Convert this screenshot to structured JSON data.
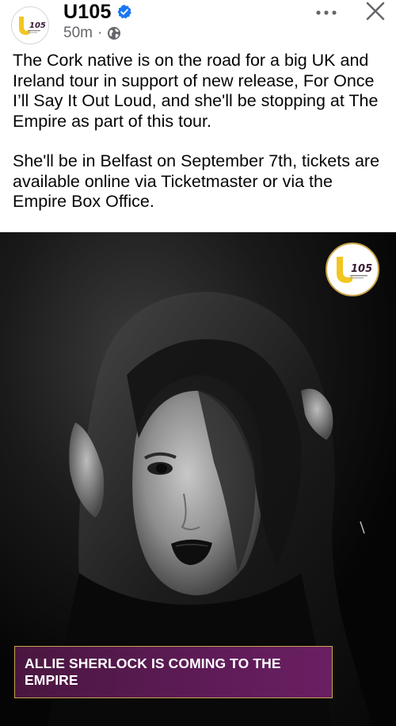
{
  "header": {
    "page_name": "U105",
    "timestamp": "50m",
    "separator": "·",
    "avatar_logo_text": "105",
    "avatar_logo_letter": "U",
    "verified_icon": "verified-badge-icon",
    "audience_icon": "globe-icon",
    "more_icon": "more-horizontal-icon",
    "close_icon": "close-icon"
  },
  "post": {
    "paragraphs": [
      "The Cork native is on the road for a big UK and Ireland tour in support of new release, For Once I’ll Say It Out Loud, and she'll be stopping at The Empire as part of this tour.",
      "She'll be in Belfast on September 7th, tickets are available online via Ticketmaster or via the Empire Box Office."
    ]
  },
  "image": {
    "logo_letter": "U",
    "logo_text": "105",
    "banner_text": "ALLIE SHERLOCK IS COMING TO THE EMPIRE"
  },
  "colors": {
    "text": "#050505",
    "meta": "#65676b",
    "verified": "#1877f2",
    "brand_yellow": "#f2c61f",
    "brand_purple": "#5e1b57",
    "banner_border": "#c9a44a"
  }
}
